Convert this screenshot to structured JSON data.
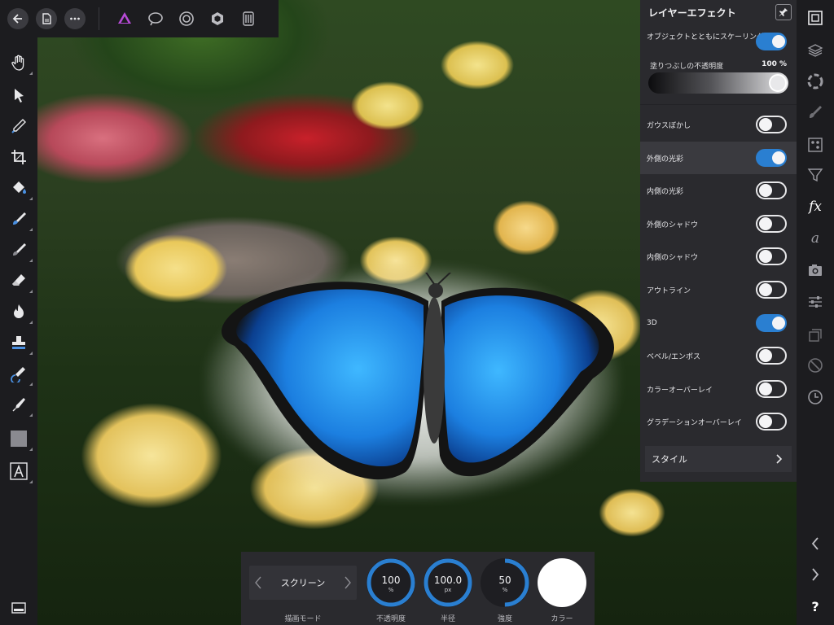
{
  "toolbar": {
    "back_icon": "back-arrow-icon",
    "document_icon": "document-icon",
    "more_icon": "more-icon",
    "personas": [
      "photo-persona-icon",
      "liquify-persona-icon",
      "develop-persona-icon",
      "tone-mapping-persona-icon",
      "export-persona-icon"
    ]
  },
  "left_tools": [
    "hand-icon",
    "move-icon",
    "color-picker-icon",
    "crop-icon",
    "flood-fill-icon",
    "selection-brush-icon",
    "paint-brush-icon",
    "erase-brush-icon",
    "burn-brush-icon",
    "clone-brush-icon",
    "healing-brush-icon",
    "pen-icon",
    "shape-icon",
    "text-icon",
    "quick-menu-icon"
  ],
  "right_tools": [
    "navigator-icon",
    "layers-icon",
    "adjustments-icon",
    "brushes-icon",
    "channels-icon",
    "filters-icon",
    "layer-effects-icon",
    "text-styles-icon",
    "snapshots-icon",
    "adjust-sliders-icon",
    "transform-icon",
    "history-icon",
    "clock-icon",
    "back-chevron-icon",
    "forward-chevron-icon",
    "help-icon"
  ],
  "right_strip": {
    "fx_label": "fx",
    "a_label": "a",
    "help_label": "?"
  },
  "panel": {
    "title": "レイヤーエフェクト",
    "scale_with_object": {
      "label": "オブジェクトとともにスケーリング",
      "on": true
    },
    "fill_opacity": {
      "label": "塗りつぶしの不透明度",
      "value": "100 %"
    },
    "effects": [
      {
        "label": "ガウスぼかし",
        "on": false,
        "selected": false
      },
      {
        "label": "外側の光彩",
        "on": true,
        "selected": true
      },
      {
        "label": "内側の光彩",
        "on": false,
        "selected": false
      },
      {
        "label": "外側のシャドウ",
        "on": false,
        "selected": false
      },
      {
        "label": "内側のシャドウ",
        "on": false,
        "selected": false
      },
      {
        "label": "アウトライン",
        "on": false,
        "selected": false
      },
      {
        "label": "3D",
        "on": true,
        "selected": false
      },
      {
        "label": "ベベル/エンボス",
        "on": false,
        "selected": false
      },
      {
        "label": "カラーオーバーレイ",
        "on": false,
        "selected": false
      },
      {
        "label": "グラデーションオーバーレイ",
        "on": false,
        "selected": false
      }
    ],
    "style_label": "スタイル"
  },
  "context": {
    "blend_mode": {
      "value": "スクリーン",
      "label": "描画モード"
    },
    "opacity": {
      "value": "100",
      "unit": "%",
      "label": "不透明度",
      "fraction": 1.0
    },
    "radius": {
      "value": "100.0",
      "unit": "px",
      "label": "半径",
      "fraction": 1.0
    },
    "intensity": {
      "value": "50",
      "unit": "%",
      "label": "強度",
      "fraction": 0.5
    },
    "color": {
      "label": "カラー",
      "hex": "#ffffff"
    }
  },
  "colors": {
    "accent": "#2a7fd1",
    "panel": "#2a2a2e",
    "chrome": "#1c1c1f"
  }
}
